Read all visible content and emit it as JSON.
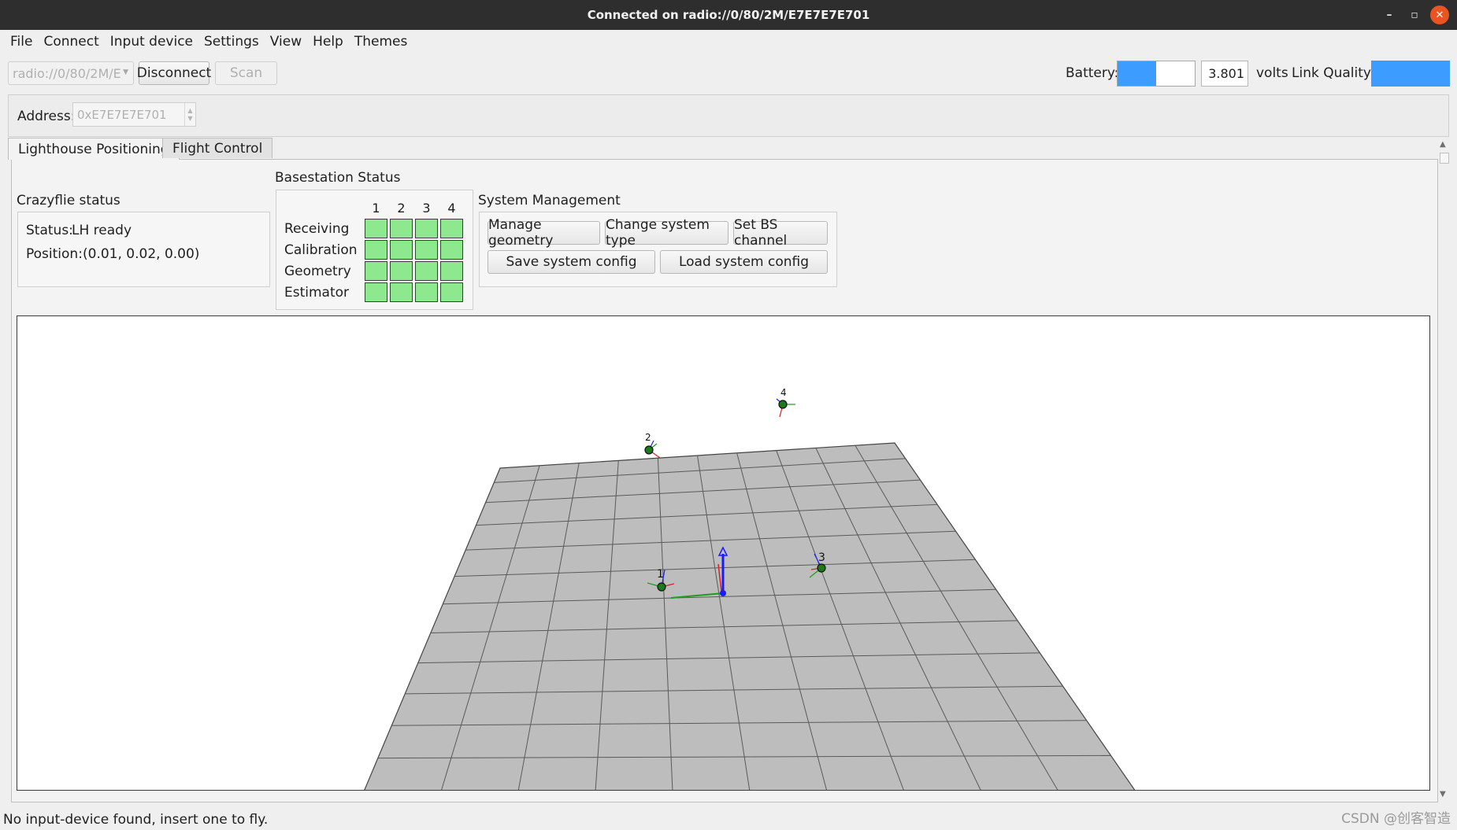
{
  "window": {
    "title": "Connected on radio://0/80/2M/E7E7E7E701",
    "minimize_glyph": "–",
    "maximize_glyph": "▫",
    "close_glyph": "✕"
  },
  "menu": [
    "File",
    "Connect",
    "Input device",
    "Settings",
    "View",
    "Help",
    "Themes"
  ],
  "toolbar": {
    "uri_value": "radio://0/80/2M/E",
    "disconnect_label": "Disconnect",
    "scan_label": "Scan",
    "battery_label": "Battery:",
    "battery_level": 0.5,
    "voltage_value": "3.801",
    "volts_label": "volts",
    "link_quality_label": "Link Quality:",
    "link_quality_level": 1.0,
    "accent_color": "#3c9cff"
  },
  "address": {
    "label": "Address:",
    "value": "0xE7E7E7E701"
  },
  "tabs": [
    {
      "label": "Lighthouse Positioning",
      "active": true
    },
    {
      "label": "Flight Control",
      "active": false
    }
  ],
  "crazyflie_status": {
    "title": "Crazyflie status",
    "status_label": "Status:",
    "status_value": "LH ready",
    "position_label": "Position:",
    "position_value": "(0.01, 0.02, 0.00)"
  },
  "basestation_status": {
    "title": "Basestation Status",
    "columns": [
      "1",
      "2",
      "3",
      "4"
    ],
    "rows": [
      "Receiving",
      "Calibration",
      "Geometry",
      "Estimator"
    ],
    "ok_color": "#8ee88e"
  },
  "system_management": {
    "title": "System Management",
    "manage_geometry": "Manage geometry",
    "change_system_type": "Change system type",
    "set_bs_channel": "Set BS channel",
    "save_system_config": "Save system config",
    "load_system_config": "Load system config"
  },
  "scene": {
    "basestation_labels": [
      "1",
      "2",
      "3",
      "4"
    ]
  },
  "statusbar": {
    "message": "No input-device found, insert one to fly."
  },
  "watermark": "CSDN @创客智造"
}
